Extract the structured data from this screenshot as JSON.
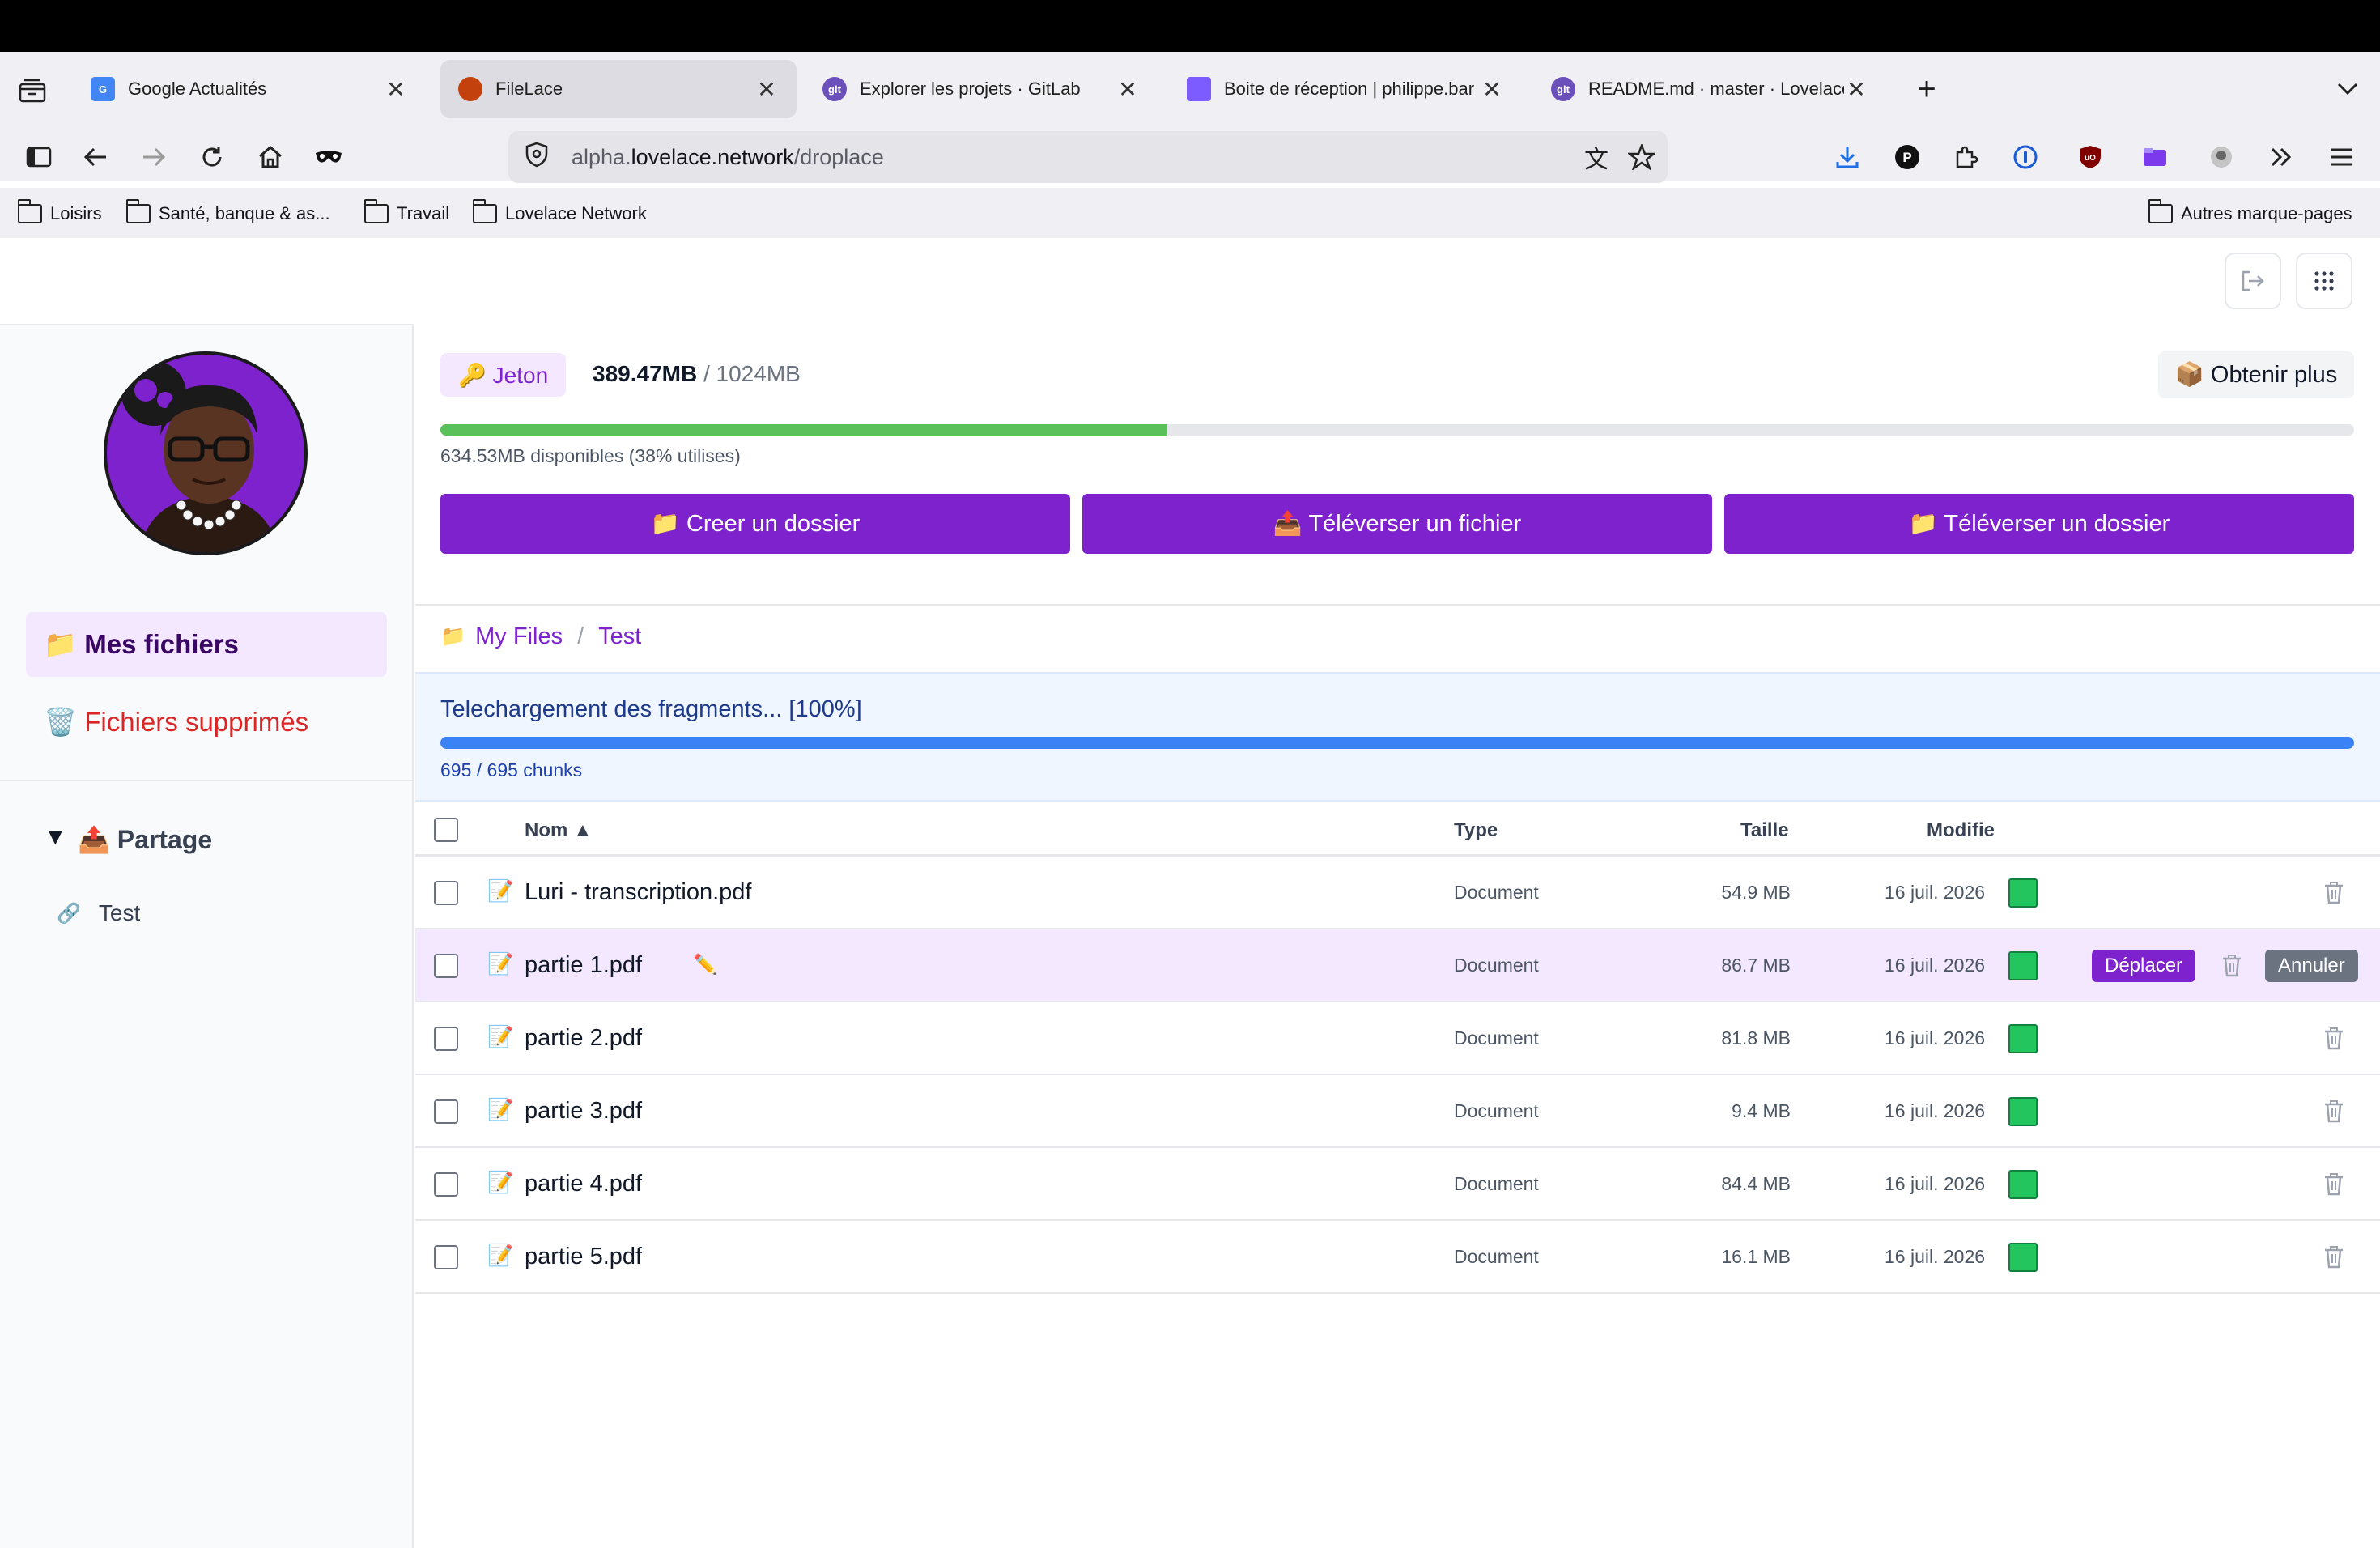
{
  "browser": {
    "tabs": [
      {
        "label": "Google Actualités",
        "favicon_color": "#4285f4"
      },
      {
        "label": "FileLace",
        "favicon_color": "#c2410c"
      },
      {
        "label": "Explorer les projets · GitLab",
        "favicon_color": "#6b4fbb"
      },
      {
        "label": "Boite de réception | philippe.bar",
        "favicon_color": "#7c5cff"
      },
      {
        "label": "README.md · master · Lovelace",
        "favicon_color": "#6b4fbb"
      }
    ],
    "favicon_text": {
      "google": "G",
      "git": "git"
    },
    "url": {
      "prefix": "alpha.",
      "host": "lovelace.network",
      "path": "/droplace"
    },
    "bookmarks": [
      "Loisirs",
      "Santé, banque & as...",
      "Travail",
      "Lovelace Network"
    ],
    "other_bookmarks": "Autres marque-pages"
  },
  "quota": {
    "badge": "🔑 Jeton",
    "used": "389.47MB",
    "separator": " / ",
    "total": "1024MB",
    "get_more": "📦 Obtenir plus",
    "used_fraction": 0.38,
    "available_text": "634.53MB disponibles (38% utilises)"
  },
  "actions": {
    "create_folder": "📁 Creer un dossier",
    "upload_file": "📤 Téléverser un fichier",
    "upload_folder": "📁 Téléverser un dossier"
  },
  "sidebar": {
    "my_files": "📁 Mes fichiers",
    "deleted_files": "🗑️ Fichiers supprimés",
    "sharing_toggle": "▼",
    "sharing": "📤 Partage",
    "share_items": [
      {
        "icon": "🔗",
        "label": "Test"
      }
    ]
  },
  "breadcrumb": {
    "icon": "📁",
    "root": "My Files",
    "separator": "/",
    "current": "Test"
  },
  "download": {
    "title": "Telechargement des fragments... [100%]",
    "progress_fraction": 1.0,
    "chunks": "695 / 695 chunks"
  },
  "table": {
    "headers": {
      "name": "Nom ▲",
      "type": "Type",
      "size": "Taille",
      "modified": "Modifie"
    },
    "rows": [
      {
        "icon": "📝",
        "name": "Luri - transcription.pdf",
        "type": "Document",
        "size": "54.9 MB",
        "date": "16 juil. 2026"
      },
      {
        "icon": "📝",
        "name": "partie 1.pdf",
        "edit": "✏️",
        "type": "Document",
        "size": "86.7 MB",
        "date": "16 juil. 2026",
        "move": "Déplacer",
        "cancel": "Annuler"
      },
      {
        "icon": "📝",
        "name": "partie 2.pdf",
        "type": "Document",
        "size": "81.8 MB",
        "date": "16 juil. 2026"
      },
      {
        "icon": "📝",
        "name": "partie 3.pdf",
        "type": "Document",
        "size": "9.4 MB",
        "date": "16 juil. 2026"
      },
      {
        "icon": "📝",
        "name": "partie 4.pdf",
        "type": "Document",
        "size": "84.4 MB",
        "date": "16 juil. 2026"
      },
      {
        "icon": "📝",
        "name": "partie 5.pdf",
        "type": "Document",
        "size": "16.1 MB",
        "date": "16 juil. 2026"
      }
    ]
  },
  "colors": {
    "accent": "#7e22ce",
    "quota_bar": "#5ac05a",
    "download_bar": "#3b82f6",
    "deleted": "#dc2626",
    "synced": "#22c55e"
  }
}
